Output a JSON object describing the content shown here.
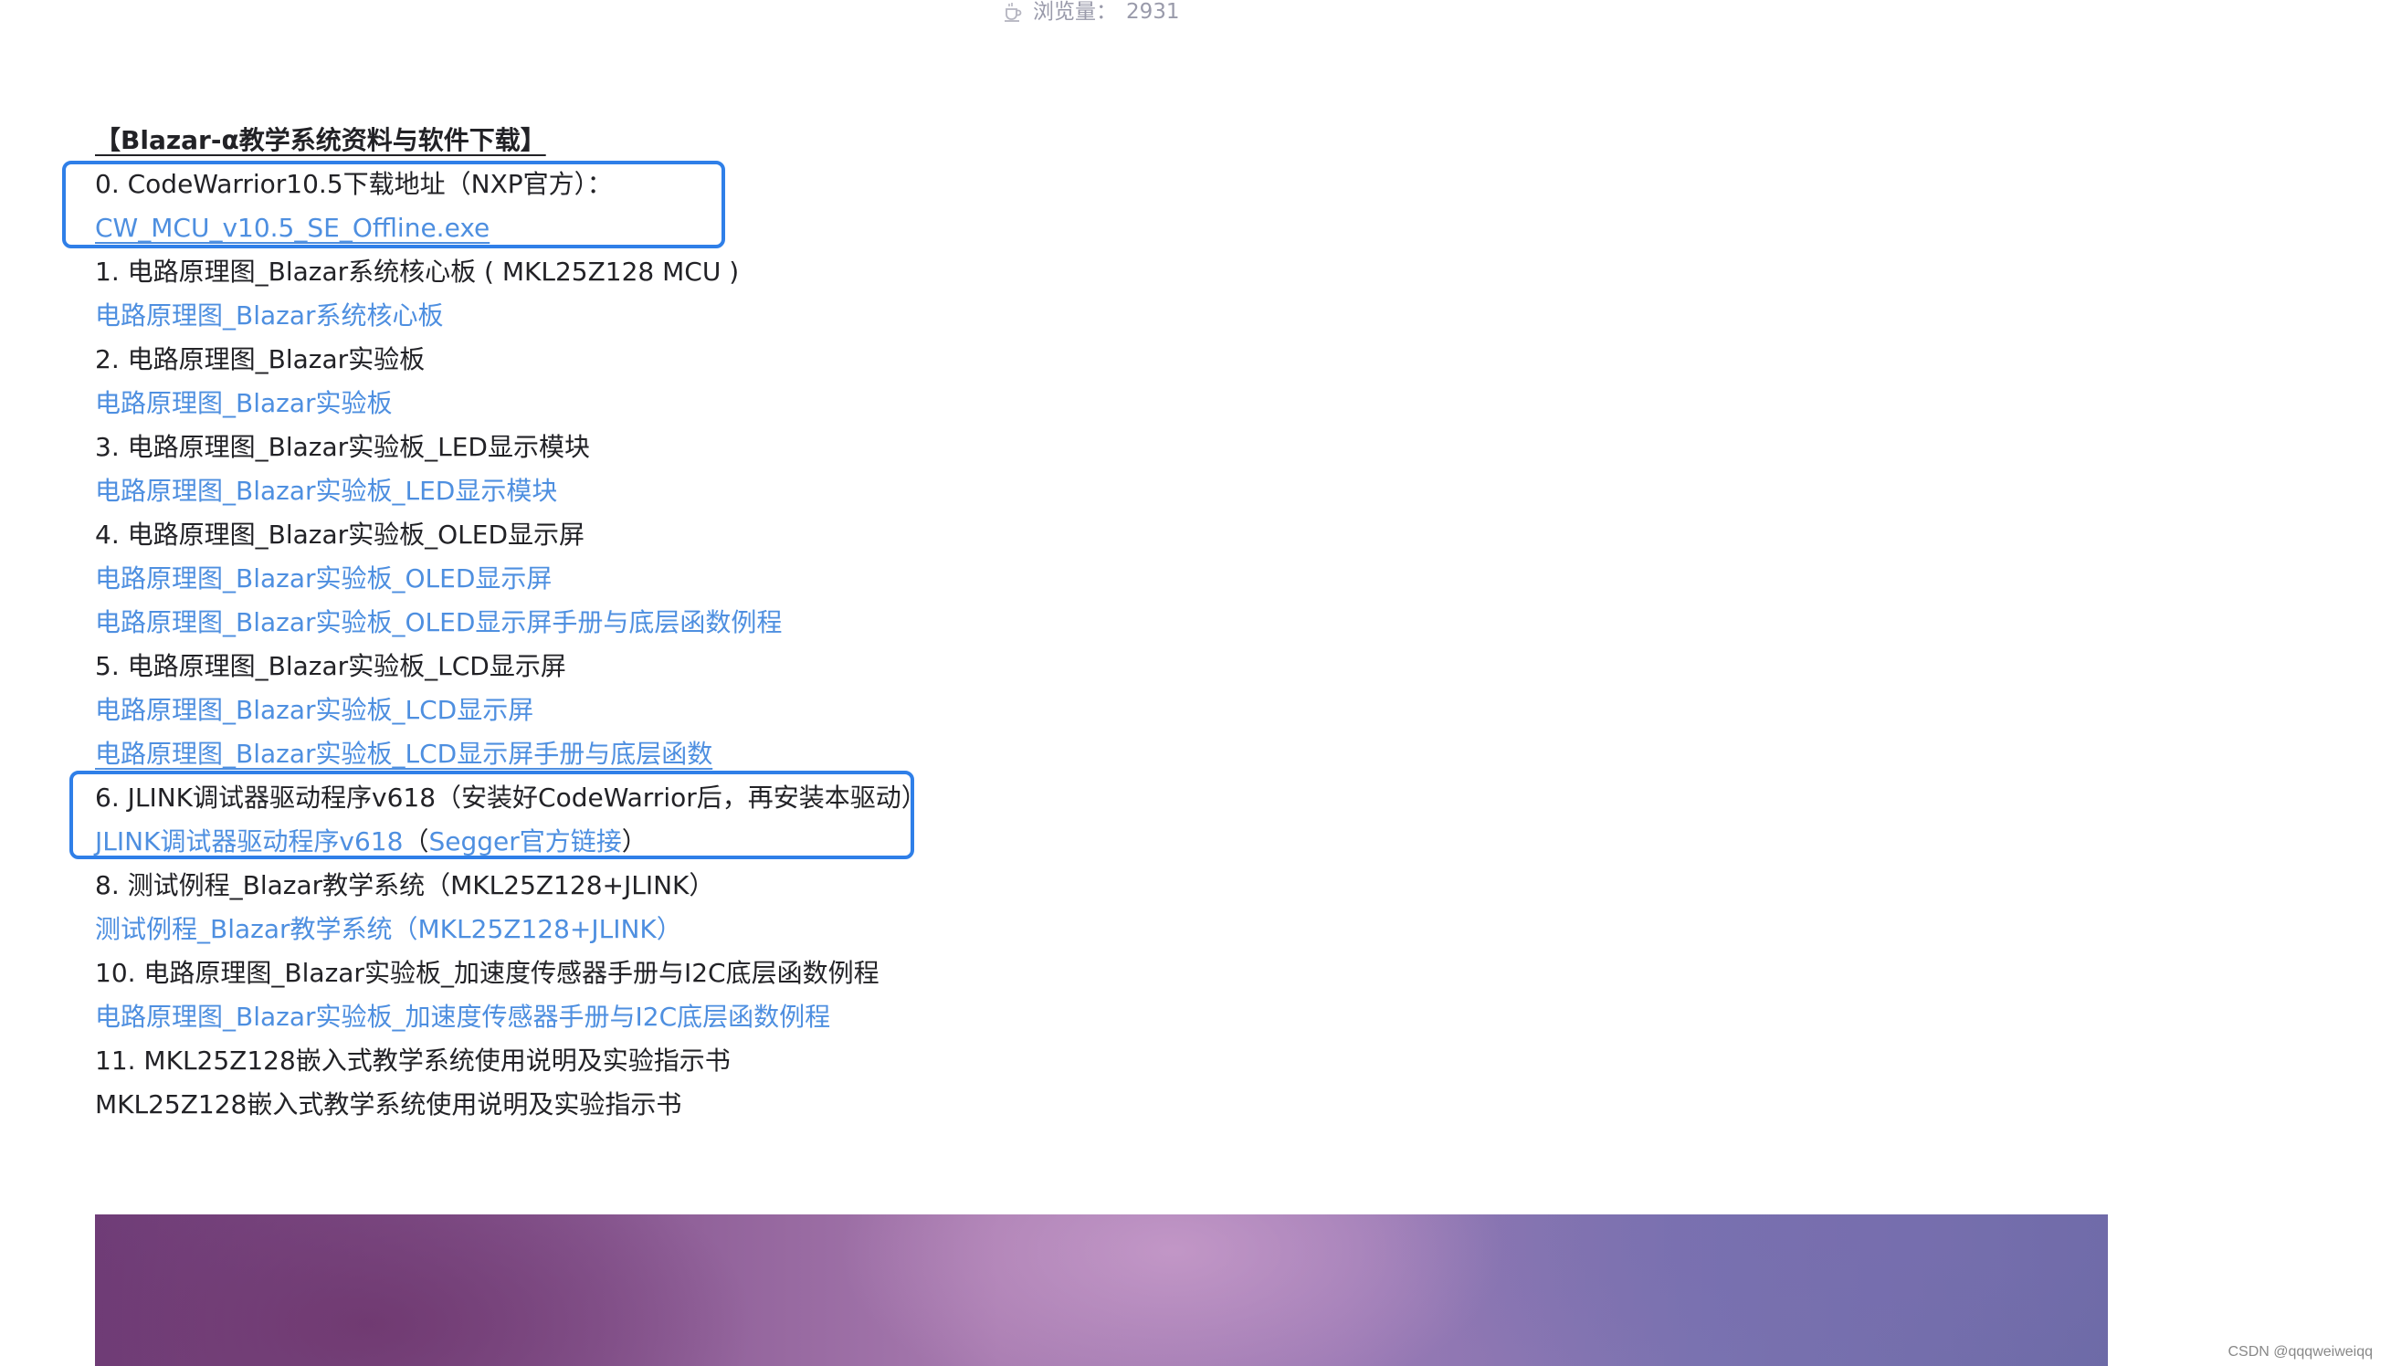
{
  "header": {
    "views_label": "浏览量：",
    "views_count": "2931"
  },
  "article": {
    "heading": "【Blazar-α教学系统资料与软件下载】",
    "items": [
      {
        "text": "0. CodeWarrior10.5下载地址（NXP官方）："
      },
      {
        "link": "CW_MCU_v10.5_SE_Offline.exe"
      },
      {
        "text": "1. 电路原理图_Blazar系统核心板 ( MKL25Z128 MCU )"
      },
      {
        "link": "电路原理图_Blazar系统核心板"
      },
      {
        "text": "2. 电路原理图_Blazar实验板"
      },
      {
        "link": "电路原理图_Blazar实验板"
      },
      {
        "text": "3. 电路原理图_Blazar实验板_LED显示模块"
      },
      {
        "link": "电路原理图_Blazar实验板_LED显示模块"
      },
      {
        "text": "4. 电路原理图_Blazar实验板_OLED显示屏"
      },
      {
        "link": "电路原理图_Blazar实验板_OLED显示屏"
      },
      {
        "link": "电路原理图_Blazar实验板_OLED显示屏手册与底层函数例程"
      },
      {
        "text": "5. 电路原理图_Blazar实验板_LCD显示屏"
      },
      {
        "link": "电路原理图_Blazar实验板_LCD显示屏"
      },
      {
        "link": "电路原理图_Blazar实验板_LCD显示屏手册与底层函数"
      },
      {
        "text": "6. JLINK调试器驱动程序v618（安装好CodeWarrior后，再安装本驱动）"
      },
      {
        "link": "JLINK调试器驱动程序v618",
        "mid": "（",
        "link2": "Segger官方链接",
        "tail": "）"
      },
      {
        "text": "8. 测试例程_Blazar教学系统（MKL25Z128+JLINK）"
      },
      {
        "link": "测试例程_Blazar教学系统（MKL25Z128+JLINK）"
      },
      {
        "text": "10. 电路原理图_Blazar实验板_加速度传感器手册与I2C底层函数例程"
      },
      {
        "link": "电路原理图_Blazar实验板_加速度传感器手册与I2C底层函数例程"
      },
      {
        "text": "11. MKL25Z128嵌入式教学系统使用说明及实验指示书"
      },
      {
        "text": "MKL25Z128嵌入式教学系统使用说明及实验指示书"
      }
    ]
  },
  "watermark": "CSDN @qqqweiweiqq",
  "colors": {
    "link": "#4e8fe0",
    "highlight_box": "#2f7fe8",
    "text": "#222226",
    "muted": "#999aaa"
  }
}
